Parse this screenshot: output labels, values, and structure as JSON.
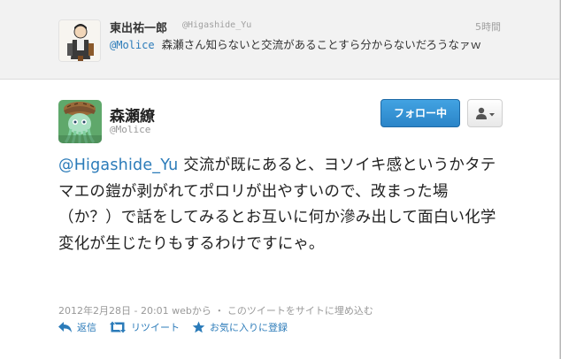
{
  "parent_tweet": {
    "fullname": "東出祐一郎",
    "username": "@Higashide_Yu",
    "time": "5時間",
    "mention": "@Molice",
    "text": "森瀬さん知らないと交流があることすら分からないだろうなァｗ",
    "avatar_icon": "character-illustration-avatar"
  },
  "tweet": {
    "fullname": "森瀬繚",
    "username": "@Molice",
    "avatar_icon": "cthulhu-detective-avatar",
    "mention": "@Higashide_Yu",
    "text": " 交流が既にあると、ヨソイキ感というかタテマエの鎧が剥がれてポロリが出やすいので、改まった場（か？）で話をしてみるとお互いに何か滲み出して面白い化学変化が生じたりもするわけですにゃ。",
    "timestamp": "2012年2月28日 - 20:01 webから ・ このツイートをサイトに埋め込む"
  },
  "buttons": {
    "follow": "フォロー中",
    "user_menu_icon": "person-dropdown-icon"
  },
  "actions": {
    "reply": "返信",
    "retweet": "リツイート",
    "favorite": "お気に入りに登録"
  },
  "colors": {
    "link": "#2b7bb9",
    "follow_button": "#2b85c8",
    "parent_background": "#f2f2f2"
  }
}
